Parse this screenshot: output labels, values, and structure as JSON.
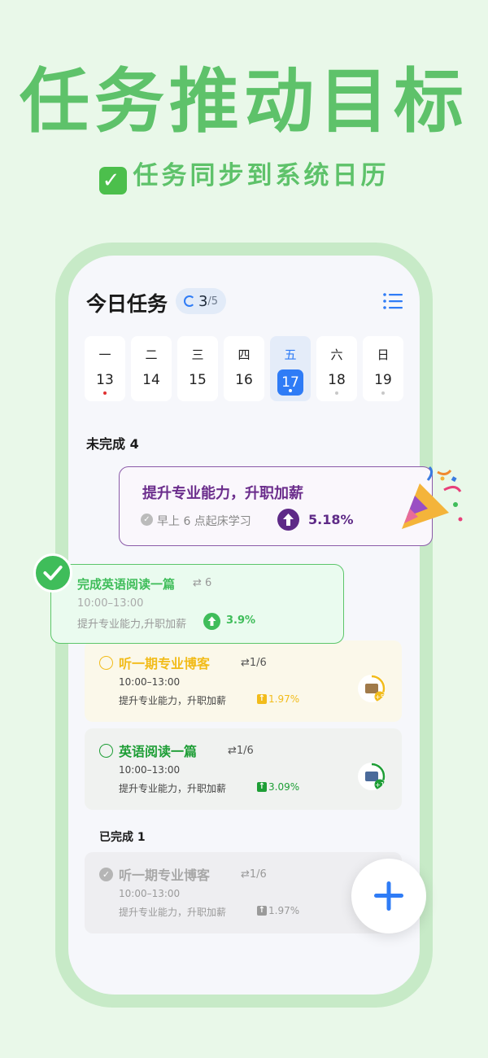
{
  "promo": {
    "headline": "任务推动目标",
    "subline": "任务同步到系统日历",
    "check_glyph": "✓"
  },
  "header": {
    "title": "今日任务",
    "progress_done": "3",
    "progress_total": "/5",
    "menu_icon": "list-icon"
  },
  "week": [
    {
      "weekday": "一",
      "day": "13",
      "dot": "#e03030"
    },
    {
      "weekday": "二",
      "day": "14",
      "dot": ""
    },
    {
      "weekday": "三",
      "day": "15",
      "dot": ""
    },
    {
      "weekday": "四",
      "day": "16",
      "dot": ""
    },
    {
      "weekday": "五",
      "day": "17",
      "dot": "#ffffff",
      "active": true
    },
    {
      "weekday": "六",
      "day": "18",
      "dot": "#c8c8c8"
    },
    {
      "weekday": "日",
      "day": "19",
      "dot": "#c8c8c8"
    }
  ],
  "sections": {
    "incomplete": "未完成 4",
    "complete": "已完成 1"
  },
  "goal_popup": {
    "title": "提升专业能力，升职加薪",
    "subtitle": "早上 6 点起床学习",
    "percent": "5.18%"
  },
  "done_popup": {
    "name": "完成英语阅读一篇",
    "repeat": "⇄ 6",
    "time": "10:00–13:00",
    "goal": "提升专业能力,升职加薪",
    "percent": "3.9%"
  },
  "tasks": [
    {
      "name": "听一期专业博客",
      "repeat": "⇄1/6",
      "time": "10:00–13:00",
      "goal": "提升专业能力，升职加薪",
      "percent": "1.97%",
      "badge": "+5",
      "bg": "#fbf8ea",
      "accent": "#f2bc1b",
      "progress": 0.3
    },
    {
      "name": "英语阅读一篇",
      "repeat": "⇄1/6",
      "time": "10:00–13:00",
      "goal": "提升专业能力，升职加薪",
      "percent": "3.09%",
      "badge": "+1",
      "bg": "#f0f2f0",
      "accent": "#1e9e36",
      "progress": 0.3
    },
    {
      "name": "听一期专业博客",
      "repeat": "⇄1/6",
      "time": "10:00–13:00",
      "goal": "提升专业能力，升职加薪",
      "percent": "1.97%",
      "bg": "#eeeef1",
      "accent": "#aaaaaa",
      "done": true
    }
  ],
  "fab": {
    "icon": "plus-icon"
  },
  "colors": {
    "promo_green": "#5ec26a",
    "blue": "#2f7cf6",
    "purple": "#5e2a87",
    "done_green": "#3fbd5a"
  }
}
